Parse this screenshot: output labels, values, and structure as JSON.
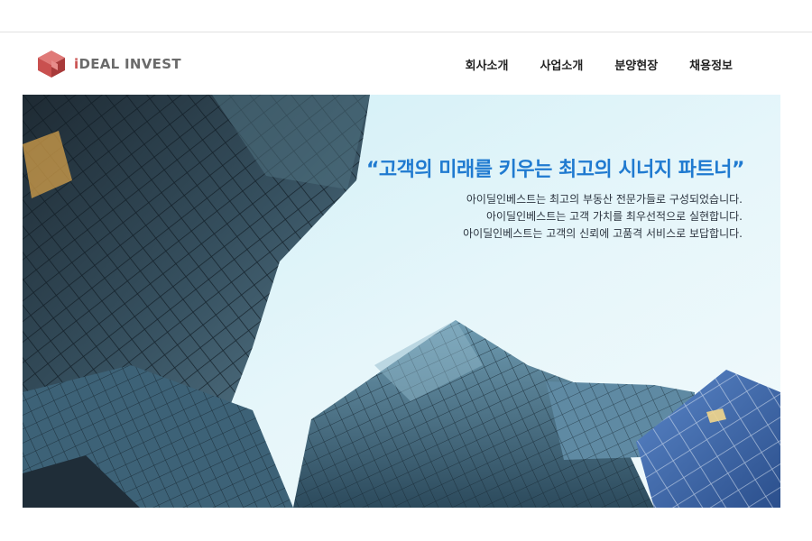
{
  "brand": {
    "name_accent": "i",
    "name_rest": "DEAL INVEST",
    "accent_color": "#c9504f"
  },
  "nav": {
    "items": [
      {
        "label": "회사소개"
      },
      {
        "label": "사업소개"
      },
      {
        "label": "분양현장"
      },
      {
        "label": "채용정보"
      }
    ]
  },
  "hero": {
    "title": "“고객의 미래를 키우는 최고의 시너지 파트너”",
    "title_color": "#1f7ad0",
    "lines": [
      "아이딜인베스트는 최고의 부동산 전문가들로 구성되었습니다.",
      "아이딜인베스트는 고객 가치를 최우선적으로 실현합니다.",
      "아이딜인베스트는 고객의 신뢰에 고품격 서비스로 보답합니다."
    ]
  }
}
